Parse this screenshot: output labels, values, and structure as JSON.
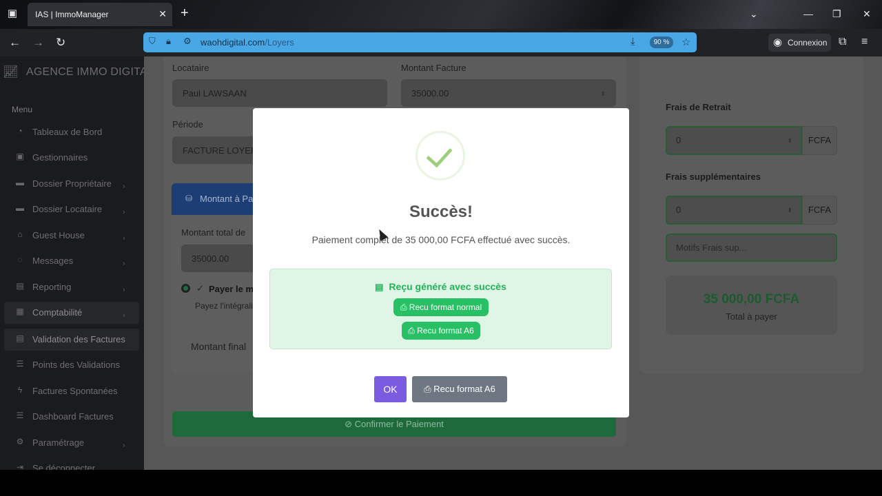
{
  "browser": {
    "tab_title": "IAS | ImmoManager",
    "url_domain": "waohdigital.com",
    "url_path": "/Loyers",
    "zoom": "90 %",
    "connexion_label": "Connexion"
  },
  "sidebar": {
    "brand": "AGENCE IMMO DIGITALE",
    "menu_label": "Menu",
    "items": [
      {
        "label": "Tableaux de Bord",
        "icon": "dashboard-icon",
        "has_chevron": false
      },
      {
        "label": "Gestionnaires",
        "icon": "id-card-icon",
        "has_chevron": false
      },
      {
        "label": "Dossier Propriétaire",
        "icon": "folder-icon",
        "has_chevron": true
      },
      {
        "label": "Dossier Locataire",
        "icon": "folder-icon",
        "has_chevron": true
      },
      {
        "label": "Guest House",
        "icon": "house-icon",
        "has_chevron": true
      },
      {
        "label": "Messages",
        "icon": "chat-icon",
        "has_chevron": true
      },
      {
        "label": "Reporting",
        "icon": "report-icon",
        "has_chevron": true
      },
      {
        "label": "Comptabilité",
        "icon": "calculator-icon",
        "has_chevron": true
      },
      {
        "label": "Validation des Factures",
        "icon": "invoice-icon",
        "has_chevron": false
      },
      {
        "label": "Points des Validations",
        "icon": "list-icon",
        "has_chevron": false
      },
      {
        "label": "Factures Spontanées",
        "icon": "bolt-icon",
        "has_chevron": false
      },
      {
        "label": "Dashboard Factures",
        "icon": "list-icon",
        "has_chevron": false
      },
      {
        "label": "Paramétrage",
        "icon": "gear-icon",
        "has_chevron": true
      },
      {
        "label": "Se déconnecter",
        "icon": "logout-icon",
        "has_chevron": false
      }
    ]
  },
  "form": {
    "locataire_label": "Locataire",
    "locataire_value": "Paul LAWSAAN",
    "montant_facture_label": "Montant Facture",
    "montant_facture_value": "35000.00",
    "periode_label": "Période",
    "periode_value": "FACTURE LOYERS-",
    "montant_a_payer_header": "Montant à Pa",
    "montant_total_label": "Montant total de",
    "montant_total_value": "35000.00",
    "payer_label": "Payer le m",
    "payer_hint": "Payez l'intégralit",
    "montant_final_label": "Montant final",
    "confirm_button": "Confirmer le Paiement"
  },
  "right_panel": {
    "frais_retrait_label": "Frais de Retrait",
    "frais_retrait_value": "0",
    "frais_supp_label": "Frais supplémentaires",
    "frais_supp_value": "0",
    "currency": "FCFA",
    "motifs_placeholder": "Motifs Frais sup...",
    "total_amount": "35 000,00 FCFA",
    "total_label": "Total à payer"
  },
  "modal": {
    "title": "Succès!",
    "message": "Paiement complet de 35 000,00 FCFA effectué avec succès.",
    "receipt_header": "Reçu généré avec succès",
    "receipt_normal_button": "Recu format normal",
    "receipt_a6_button": "Recu format A6",
    "ok_button": "OK",
    "footer_a6_button": "Recu format A6"
  }
}
